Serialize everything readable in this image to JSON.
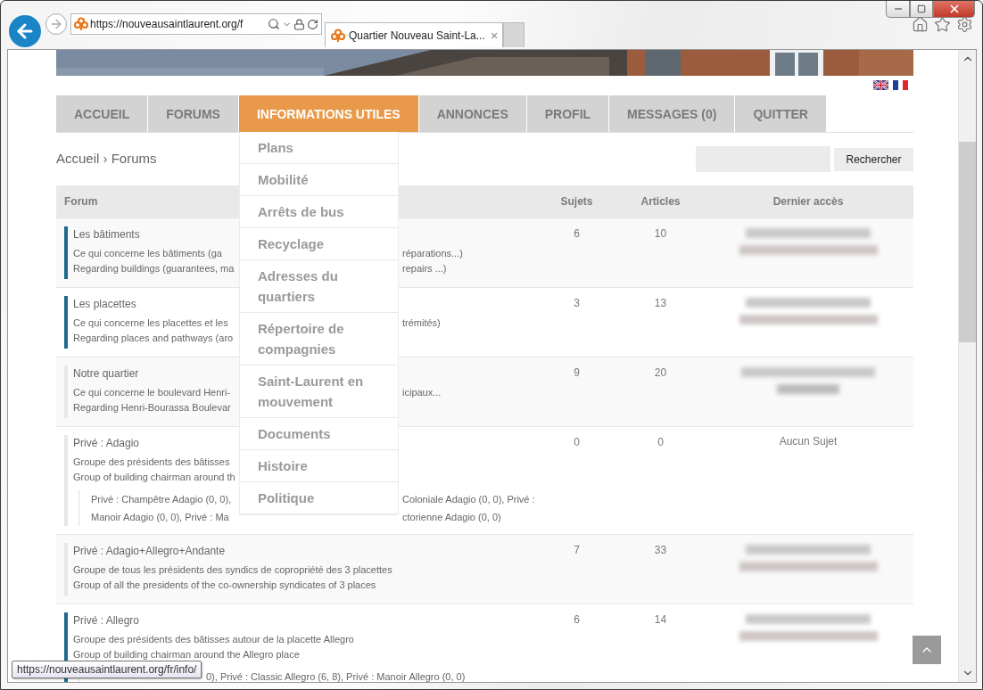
{
  "browser": {
    "address": "https://nouveausaintlaurent.org/f",
    "tab_title": "Quartier Nouveau Saint-La...",
    "tab_close": "×"
  },
  "nav": [
    {
      "label": "ACCUEIL",
      "selected": false
    },
    {
      "label": "FORUMS",
      "selected": false
    },
    {
      "label": "INFORMATIONS UTILES",
      "selected": true
    },
    {
      "label": "ANNONCES",
      "selected": false
    },
    {
      "label": "PROFIL",
      "selected": false
    },
    {
      "label": "MESSAGES (0)",
      "selected": false
    },
    {
      "label": "QUITTER",
      "selected": false
    }
  ],
  "dropdown": [
    "Plans",
    "Mobilité",
    "Arrêts de bus",
    "Recyclage",
    "Adresses du quartiers",
    "Répertoire de compagnies",
    "Saint-Laurent en mouvement",
    "Documents",
    "Histoire",
    "Politique"
  ],
  "breadcrumb": "Accueil › Forums",
  "search": {
    "button": "Rechercher"
  },
  "table": {
    "columns": [
      "Forum",
      "Sujets",
      "Articles",
      "Dernier accès"
    ],
    "rows": [
      {
        "title": "Les bâtiments",
        "unread": true,
        "description_fr": [
          "Ce qui concerne les bâtiments (ga",
          "réparations...)"
        ],
        "description_en": [
          "Regarding buildings (guarantees, ma",
          "repairs ...)"
        ],
        "topics": "6",
        "posts": "10",
        "last_access": {
          "blurred": true
        }
      },
      {
        "title": "Les placettes",
        "unread": true,
        "description_fr": [
          "Ce qui concerne les placettes et les",
          "trémités)"
        ],
        "description_en": [
          "Regarding places and pathways (aro"
        ],
        "topics": "3",
        "posts": "13",
        "last_access": {
          "blurred": true
        }
      },
      {
        "title": "Notre quartier",
        "unread": false,
        "description_fr": [
          "Ce qui concerne le boulevard Henri-",
          "icipaux..."
        ],
        "description_en": [
          "Regarding Henri-Bourassa Boulevar"
        ],
        "topics": "9",
        "posts": "20",
        "last_access": {
          "blurred": true
        }
      },
      {
        "title": "Privé : Adagio",
        "unread": false,
        "description_fr": [
          "Groupe des présidents des bâtisses"
        ],
        "description_en": [
          "Group of building chairman around th"
        ],
        "subforums": [
          [
            "Privé : Champêtre Adagio (0, 0),",
            "Coloniale Adagio (0, 0), Privé :"
          ],
          [
            "Manoir Adagio (0, 0), Privé : Ma",
            "ctorienne Adagio (0, 0)"
          ]
        ],
        "topics": "0",
        "posts": "0",
        "last_access": {
          "text": "Aucun Sujet"
        }
      },
      {
        "title": "Privé : Adagio+Allegro+Andante",
        "unread": false,
        "description_fr": "Groupe de tous les présidents des syndics de copropriété des 3 placettes",
        "description_en": "Group of all the presidents of the co-ownership syndicates of 3 places",
        "topics": "7",
        "posts": "33",
        "last_access": {
          "blurred": true
        }
      },
      {
        "title": "Privé : Allegro",
        "unread": true,
        "description_fr": "Groupe des présidents des bâtisses autour de la placette Allegro",
        "description_en": "Group of building chairman around the Allegro place",
        "subforums": "0), Privé : Classic Allegro (6, 8), Privé : Manoir Allegro (0, 0)",
        "topics": "6",
        "posts": "14",
        "last_access": {
          "blurred": true
        }
      }
    ]
  },
  "status_tooltip": "https://nouveausaintlaurent.org/fr/info/"
}
